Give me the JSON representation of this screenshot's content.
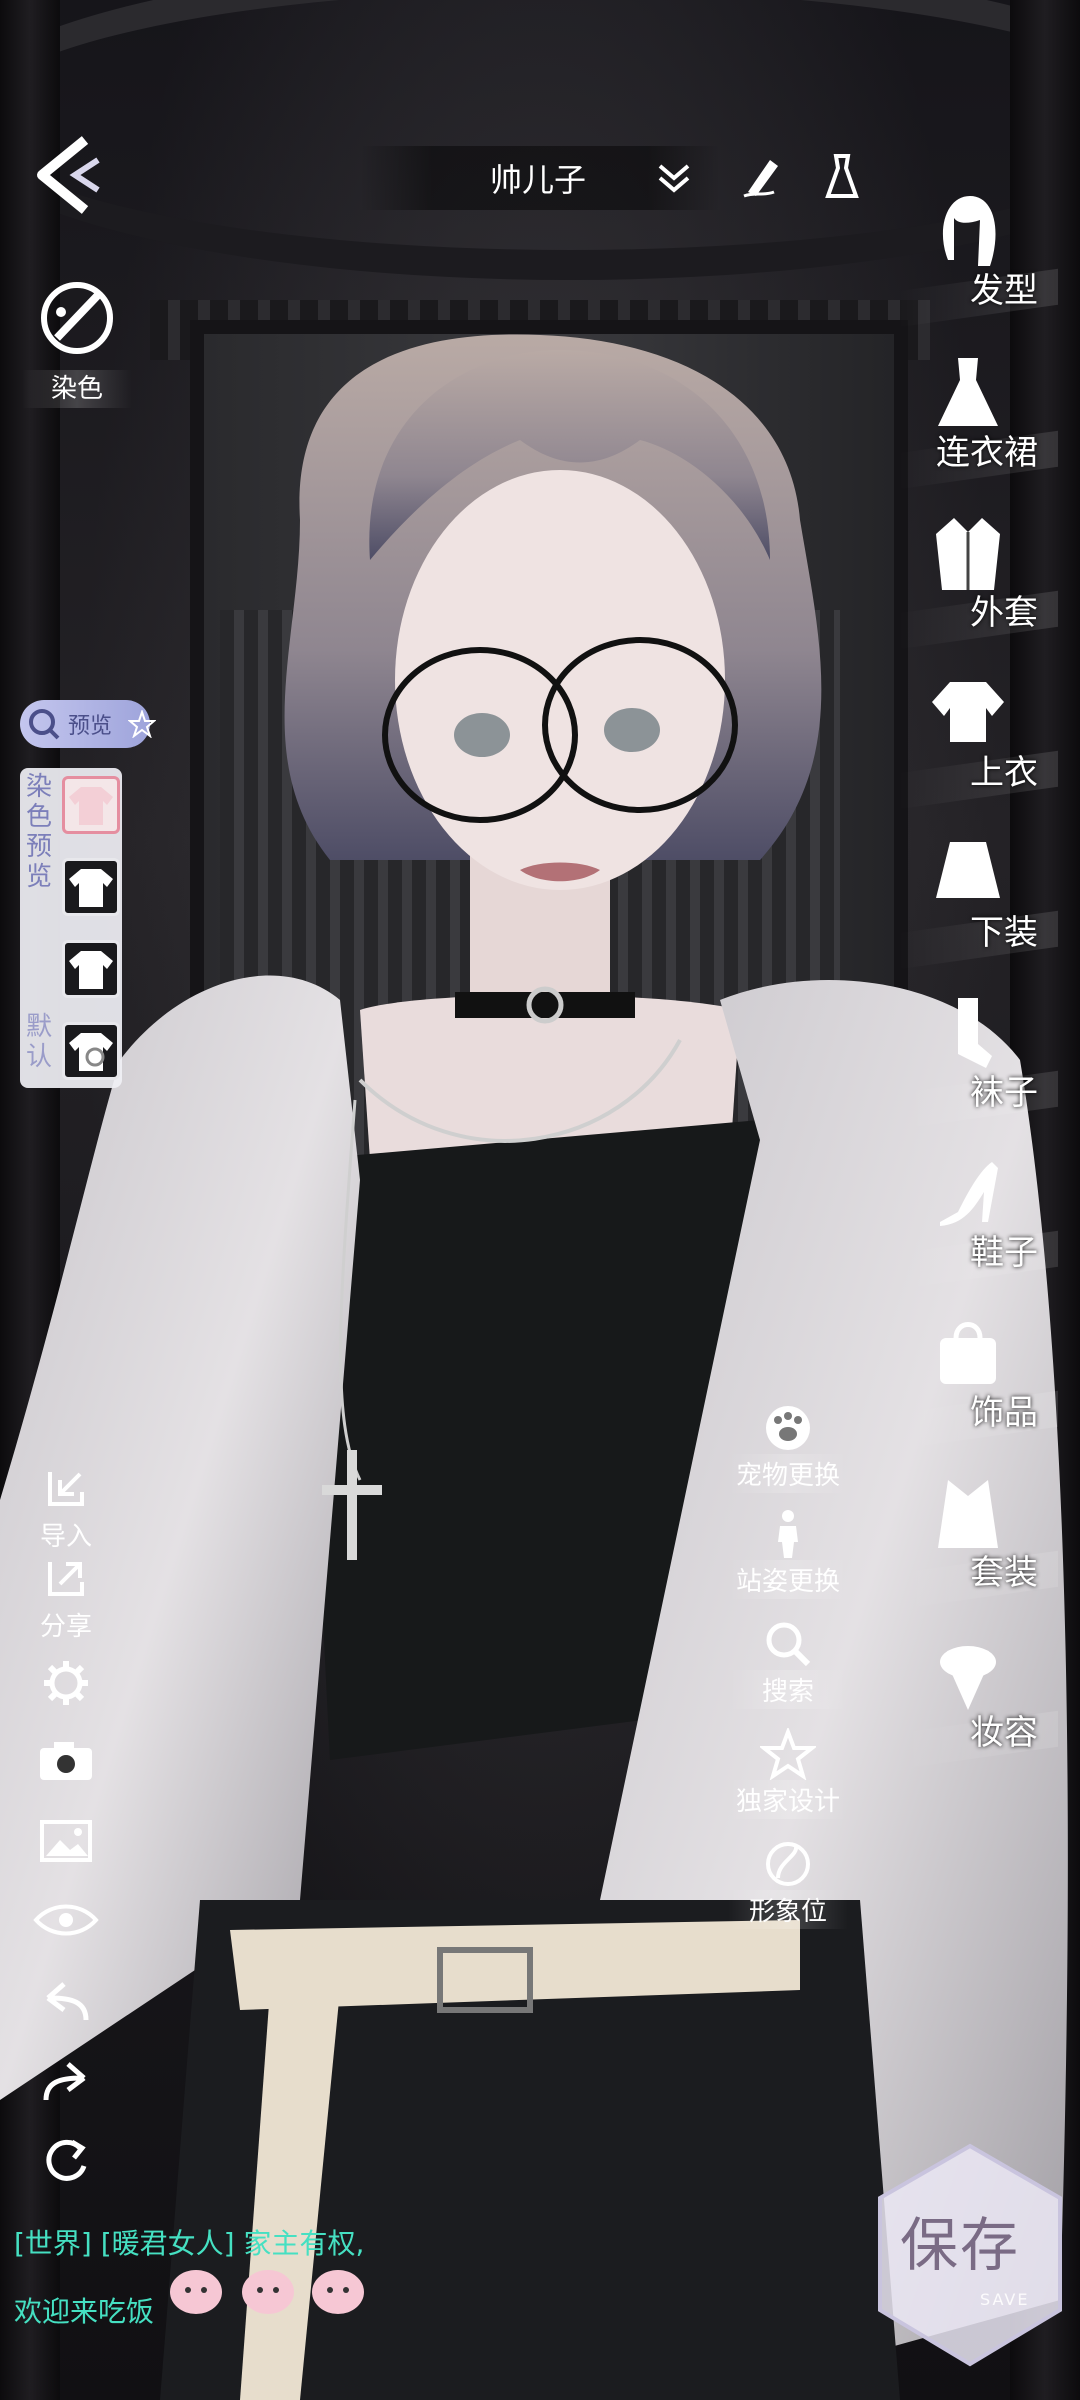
{
  "topbar": {
    "outfit_name": "帅儿子"
  },
  "dye": {
    "button_label": "染色"
  },
  "preview": {
    "pill_label": "预览",
    "panel_title_chars": [
      "染",
      "色",
      "预",
      "览"
    ],
    "panel_default_chars": [
      "默",
      "认"
    ]
  },
  "left_tools": {
    "import_label": "导入",
    "share_label": "分享"
  },
  "categories": [
    {
      "label": "发型",
      "icon": "hair-icon"
    },
    {
      "label": "连衣裙",
      "icon": "dress-icon"
    },
    {
      "label": "外套",
      "icon": "coat-icon"
    },
    {
      "label": "上衣",
      "icon": "top-icon"
    },
    {
      "label": "下装",
      "icon": "skirt-icon"
    },
    {
      "label": "袜子",
      "icon": "socks-icon"
    },
    {
      "label": "鞋子",
      "icon": "shoe-icon"
    },
    {
      "label": "饰品",
      "icon": "bag-icon"
    },
    {
      "label": "套装",
      "icon": "suit-icon"
    },
    {
      "label": "妆容",
      "icon": "makeup-icon"
    }
  ],
  "actions": {
    "pet_change": "宠物更换",
    "pose_change": "站姿更换",
    "search": "搜索",
    "exclusive_design": "独家设计",
    "image_slot": "形象位"
  },
  "save": {
    "label": "保存",
    "sub": "SAVE"
  },
  "chat": {
    "partial_line": "[世界] [暖君女人] 家主有权,",
    "welcome": "欢迎来吃饭"
  },
  "colors": {
    "accent_lavender": "#9ea4db",
    "chat_green": "#45e0c2",
    "swatch_selected": "#e58ea0"
  }
}
